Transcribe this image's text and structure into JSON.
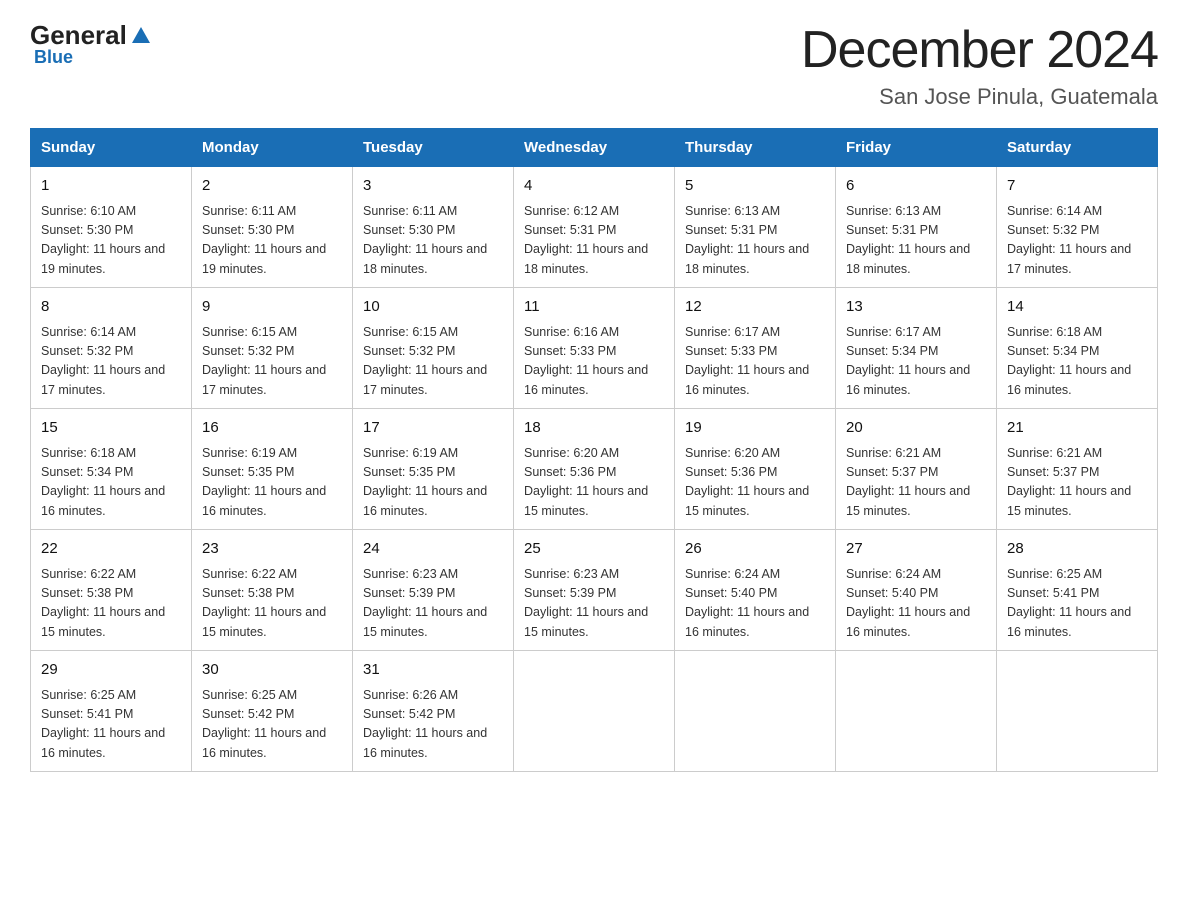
{
  "header": {
    "logo_general": "General",
    "logo_blue": "Blue",
    "month_title": "December 2024",
    "location": "San Jose Pinula, Guatemala"
  },
  "weekdays": [
    "Sunday",
    "Monday",
    "Tuesday",
    "Wednesday",
    "Thursday",
    "Friday",
    "Saturday"
  ],
  "weeks": [
    [
      {
        "day": "1",
        "sunrise": "6:10 AM",
        "sunset": "5:30 PM",
        "daylight": "11 hours and 19 minutes."
      },
      {
        "day": "2",
        "sunrise": "6:11 AM",
        "sunset": "5:30 PM",
        "daylight": "11 hours and 19 minutes."
      },
      {
        "day": "3",
        "sunrise": "6:11 AM",
        "sunset": "5:30 PM",
        "daylight": "11 hours and 18 minutes."
      },
      {
        "day": "4",
        "sunrise": "6:12 AM",
        "sunset": "5:31 PM",
        "daylight": "11 hours and 18 minutes."
      },
      {
        "day": "5",
        "sunrise": "6:13 AM",
        "sunset": "5:31 PM",
        "daylight": "11 hours and 18 minutes."
      },
      {
        "day": "6",
        "sunrise": "6:13 AM",
        "sunset": "5:31 PM",
        "daylight": "11 hours and 18 minutes."
      },
      {
        "day": "7",
        "sunrise": "6:14 AM",
        "sunset": "5:32 PM",
        "daylight": "11 hours and 17 minutes."
      }
    ],
    [
      {
        "day": "8",
        "sunrise": "6:14 AM",
        "sunset": "5:32 PM",
        "daylight": "11 hours and 17 minutes."
      },
      {
        "day": "9",
        "sunrise": "6:15 AM",
        "sunset": "5:32 PM",
        "daylight": "11 hours and 17 minutes."
      },
      {
        "day": "10",
        "sunrise": "6:15 AM",
        "sunset": "5:32 PM",
        "daylight": "11 hours and 17 minutes."
      },
      {
        "day": "11",
        "sunrise": "6:16 AM",
        "sunset": "5:33 PM",
        "daylight": "11 hours and 16 minutes."
      },
      {
        "day": "12",
        "sunrise": "6:17 AM",
        "sunset": "5:33 PM",
        "daylight": "11 hours and 16 minutes."
      },
      {
        "day": "13",
        "sunrise": "6:17 AM",
        "sunset": "5:34 PM",
        "daylight": "11 hours and 16 minutes."
      },
      {
        "day": "14",
        "sunrise": "6:18 AM",
        "sunset": "5:34 PM",
        "daylight": "11 hours and 16 minutes."
      }
    ],
    [
      {
        "day": "15",
        "sunrise": "6:18 AM",
        "sunset": "5:34 PM",
        "daylight": "11 hours and 16 minutes."
      },
      {
        "day": "16",
        "sunrise": "6:19 AM",
        "sunset": "5:35 PM",
        "daylight": "11 hours and 16 minutes."
      },
      {
        "day": "17",
        "sunrise": "6:19 AM",
        "sunset": "5:35 PM",
        "daylight": "11 hours and 16 minutes."
      },
      {
        "day": "18",
        "sunrise": "6:20 AM",
        "sunset": "5:36 PM",
        "daylight": "11 hours and 15 minutes."
      },
      {
        "day": "19",
        "sunrise": "6:20 AM",
        "sunset": "5:36 PM",
        "daylight": "11 hours and 15 minutes."
      },
      {
        "day": "20",
        "sunrise": "6:21 AM",
        "sunset": "5:37 PM",
        "daylight": "11 hours and 15 minutes."
      },
      {
        "day": "21",
        "sunrise": "6:21 AM",
        "sunset": "5:37 PM",
        "daylight": "11 hours and 15 minutes."
      }
    ],
    [
      {
        "day": "22",
        "sunrise": "6:22 AM",
        "sunset": "5:38 PM",
        "daylight": "11 hours and 15 minutes."
      },
      {
        "day": "23",
        "sunrise": "6:22 AM",
        "sunset": "5:38 PM",
        "daylight": "11 hours and 15 minutes."
      },
      {
        "day": "24",
        "sunrise": "6:23 AM",
        "sunset": "5:39 PM",
        "daylight": "11 hours and 15 minutes."
      },
      {
        "day": "25",
        "sunrise": "6:23 AM",
        "sunset": "5:39 PM",
        "daylight": "11 hours and 15 minutes."
      },
      {
        "day": "26",
        "sunrise": "6:24 AM",
        "sunset": "5:40 PM",
        "daylight": "11 hours and 16 minutes."
      },
      {
        "day": "27",
        "sunrise": "6:24 AM",
        "sunset": "5:40 PM",
        "daylight": "11 hours and 16 minutes."
      },
      {
        "day": "28",
        "sunrise": "6:25 AM",
        "sunset": "5:41 PM",
        "daylight": "11 hours and 16 minutes."
      }
    ],
    [
      {
        "day": "29",
        "sunrise": "6:25 AM",
        "sunset": "5:41 PM",
        "daylight": "11 hours and 16 minutes."
      },
      {
        "day": "30",
        "sunrise": "6:25 AM",
        "sunset": "5:42 PM",
        "daylight": "11 hours and 16 minutes."
      },
      {
        "day": "31",
        "sunrise": "6:26 AM",
        "sunset": "5:42 PM",
        "daylight": "11 hours and 16 minutes."
      },
      null,
      null,
      null,
      null
    ]
  ]
}
